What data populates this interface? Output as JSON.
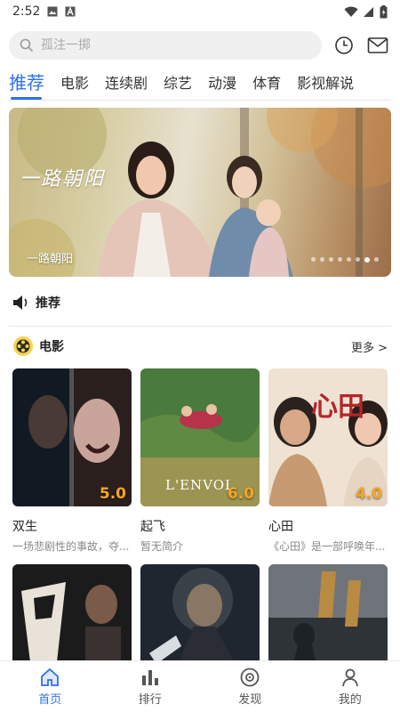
{
  "status_bar": {
    "time": "2:52"
  },
  "search": {
    "placeholder": "孤注一掷"
  },
  "tabs": [
    {
      "label": "推荐",
      "active": true
    },
    {
      "label": "电影"
    },
    {
      "label": "连续剧"
    },
    {
      "label": "综艺"
    },
    {
      "label": "动漫"
    },
    {
      "label": "体育"
    },
    {
      "label": "影视解说"
    }
  ],
  "banner": {
    "logo_text": "一路朝阳",
    "caption": "一路朝阳",
    "slide_count": 8,
    "active_slide": 6
  },
  "notice": {
    "label": "推荐"
  },
  "section": {
    "title": "电影",
    "more": "更多 >"
  },
  "movies": [
    {
      "title": "双生",
      "desc": "一场悲剧性的事故，夺...",
      "score": "5.0",
      "colors": [
        "#0f1a22",
        "#6b2a2a"
      ]
    },
    {
      "title": "起飞",
      "desc": "暂无简介",
      "score": "6.0",
      "poster_text": "L'ENVOL",
      "colors": [
        "#3f6b3a",
        "#a09a55"
      ]
    },
    {
      "title": "心田",
      "desc": "《心田》是一部呼唤年...",
      "score": "4.0",
      "poster_text": "心田",
      "colors": [
        "#e9d9c6",
        "#b97b5a"
      ]
    },
    {
      "title": "",
      "desc": "",
      "score": "",
      "colors": [
        "#1a1a1a",
        "#5a4a40"
      ]
    },
    {
      "title": "",
      "desc": "",
      "score": "",
      "colors": [
        "#2b3138",
        "#8a9096"
      ]
    },
    {
      "title": "",
      "desc": "",
      "score": "",
      "colors": [
        "#7c7f86",
        "#2f3338"
      ]
    }
  ],
  "bottom_nav": [
    {
      "label": "首页",
      "icon": "home-icon",
      "active": true
    },
    {
      "label": "排行",
      "icon": "ranking-icon"
    },
    {
      "label": "发现",
      "icon": "discover-icon"
    },
    {
      "label": "我的",
      "icon": "profile-icon"
    }
  ],
  "colors": {
    "accent": "#2f6ff2",
    "score": "#f5a623"
  }
}
